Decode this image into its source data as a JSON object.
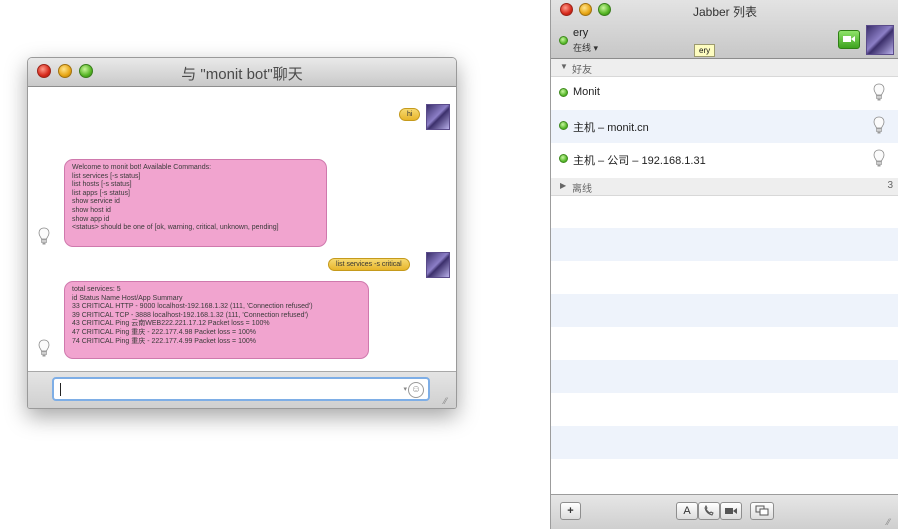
{
  "chat_window": {
    "title": "与 \"monit bot\"聊天",
    "messages": [
      {
        "from": "me",
        "text": "hi"
      },
      {
        "from": "bot",
        "lines": [
          "Welcome to monit bot! Available Commands:",
          "list services [-s status]",
          "list hosts [-s status]",
          "list apps [-s status]",
          "show service id",
          "show host id",
          "show app id",
          "<status> should be one of [ok, warning, critical, unknown, pending]"
        ]
      },
      {
        "from": "me",
        "text": "list services -s critical"
      },
      {
        "from": "bot",
        "lines": [
          "total services: 5",
          "id Status Name Host/App Summary",
          "33 CRITICAL HTTP - 9000 localhost-192.168.1.32 (111, 'Connection refused')",
          "39 CRITICAL TCP - 3888 localhost-192.168.1.32 (111, 'Connection refused')",
          "43 CRITICAL Ping 云南WEB222.221.17.12 Packet loss = 100%",
          "47 CRITICAL Ping 重庆 - 222.177.4.98 Packet loss = 100%",
          "74 CRITICAL Ping 重庆 - 222.177.4.99 Packet loss = 100%"
        ]
      }
    ],
    "input_value": ""
  },
  "list_window": {
    "title": "Jabber 列表",
    "me": {
      "name": "ery",
      "status": "在线 ▾",
      "tooltip": "ery"
    },
    "groups": [
      {
        "name": "好友",
        "expanded": true,
        "count": "",
        "buddies": [
          {
            "name": "Monit"
          },
          {
            "name": "主机 – monit.cn"
          },
          {
            "name": "主机 – 公司 – 192.168.1.31"
          }
        ]
      },
      {
        "name": "离线",
        "expanded": false,
        "count": "3"
      }
    ],
    "footer": {
      "add_label": "+",
      "font_label": "A"
    }
  },
  "colors": {
    "outgoing_bubble": "#e8b52a",
    "incoming_bubble": "#f1a4cf",
    "online_status": "#52b526",
    "stripe": "#eef3fb"
  },
  "icons": [
    "close-icon",
    "minimize-icon",
    "zoom-icon",
    "bulb-icon",
    "avatar",
    "emoji-icon",
    "video-call-icon",
    "status-dot-icon",
    "add-icon",
    "font-icon",
    "phone-icon",
    "camera-icon",
    "screen-share-icon",
    "resize-grip-icon"
  ]
}
